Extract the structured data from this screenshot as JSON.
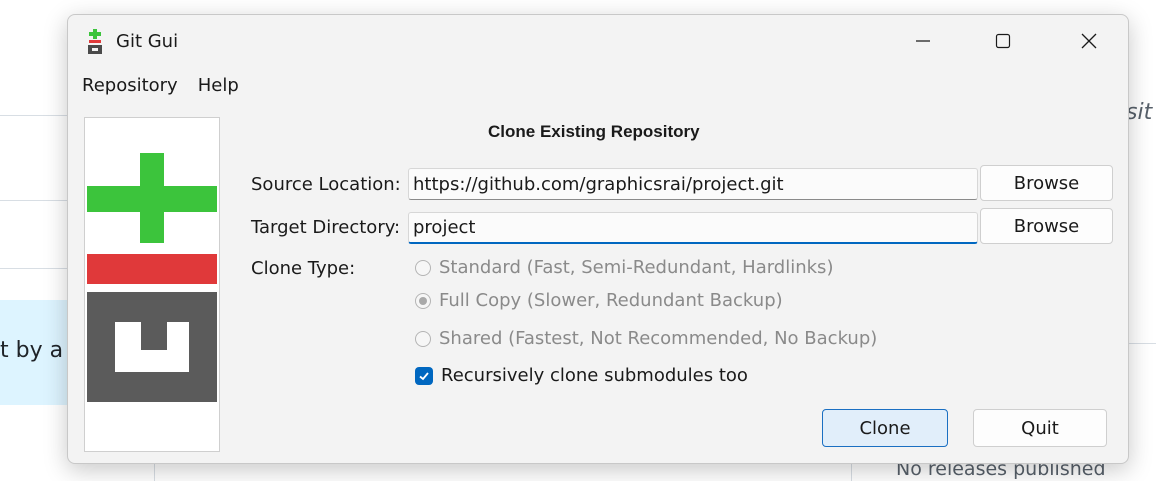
{
  "background": {
    "partial_text": "t by a",
    "italic_fragment": "sit",
    "releases_text": "No releases published"
  },
  "window": {
    "title": "Git Gui",
    "icons": {
      "app": "git-gui-icon",
      "minimize": "minimize-icon",
      "maximize": "maximize-icon",
      "close": "close-icon"
    }
  },
  "menu": [
    {
      "label": "Repository"
    },
    {
      "label": "Help"
    }
  ],
  "dialog": {
    "title": "Clone Existing Repository",
    "source_label": "Source Location:",
    "source_value": "https://github.com/graphicsrai/project.git",
    "target_label": "Target Directory:",
    "target_value": "project",
    "browse_label": "Browse",
    "clone_type_label": "Clone Type:",
    "clone_types": [
      {
        "label": "Standard (Fast, Semi-Redundant, Hardlinks)",
        "selected": false
      },
      {
        "label": "Full Copy (Slower, Redundant Backup)",
        "selected": true
      },
      {
        "label": "Shared (Fastest, Not Recommended, No Backup)",
        "selected": false
      }
    ],
    "recursive_label": "Recursively clone submodules too",
    "recursive_checked": true,
    "clone_button": "Clone",
    "quit_button": "Quit"
  },
  "colors": {
    "logo_green": "#3cc43c",
    "logo_red": "#e0393a",
    "logo_gray": "#5b5b5b",
    "accent": "#0067c0"
  }
}
